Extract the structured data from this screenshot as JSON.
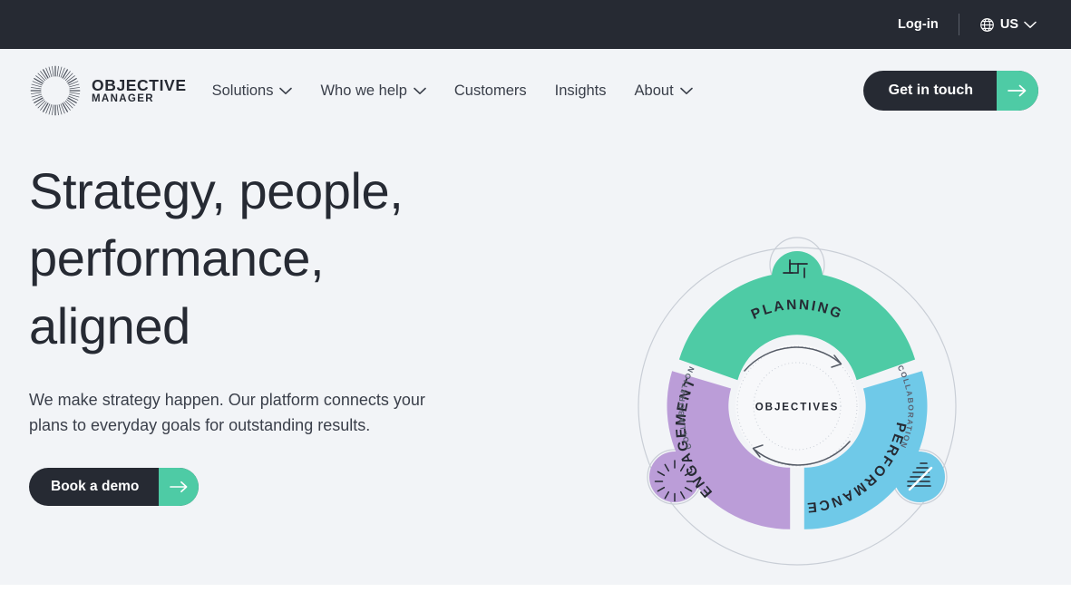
{
  "topbar": {
    "login_label": "Log-in",
    "locale_label": "US",
    "globe_icon": "globe-icon",
    "chevron_icon": "chevron-down-icon"
  },
  "brand": {
    "line1": "OBJECTIVE",
    "line2": "MANAGER",
    "mark_icon": "sunburst-logo-icon"
  },
  "nav": {
    "items": [
      {
        "label": "Solutions",
        "has_dropdown": true
      },
      {
        "label": "Who we help",
        "has_dropdown": true
      },
      {
        "label": "Customers",
        "has_dropdown": false
      },
      {
        "label": "Insights",
        "has_dropdown": false
      },
      {
        "label": "About",
        "has_dropdown": true
      }
    ]
  },
  "header_cta": {
    "label": "Get in touch",
    "arrow_icon": "arrow-right-icon"
  },
  "hero": {
    "headline": "Strategy, people,\nperformance,\naligned",
    "subcopy": "We make strategy happen. Our platform connects your\nplans to everyday goals for outstanding results.",
    "cta_label": "Book a demo",
    "cta_arrow_icon": "arrow-right-icon"
  },
  "diagram": {
    "center_label": "OBJECTIVES",
    "segments": [
      {
        "label": "PLANNING",
        "color": "#4ecba5",
        "icon": "crosshair-target-icon"
      },
      {
        "label": "PERFORMANCE",
        "color": "#6fc9e8",
        "icon": "rising-bars-icon"
      },
      {
        "label": "ENGAGEMENT",
        "color": "#bb9dd8",
        "icon": "starburst-spark-icon"
      }
    ],
    "ring_labels": [
      "COLLABORATION",
      "COLLABORATION"
    ],
    "arrow_icons": [
      "arc-arrow-clockwise-icon",
      "arc-arrow-counterclockwise-icon"
    ]
  },
  "colors": {
    "topbar_bg": "#262a33",
    "hero_bg": "#f2f4f7",
    "accent_green": "#4ecba5",
    "accent_blue": "#6fc9e8",
    "accent_purple": "#bb9dd8",
    "text_dark": "#262a33"
  }
}
